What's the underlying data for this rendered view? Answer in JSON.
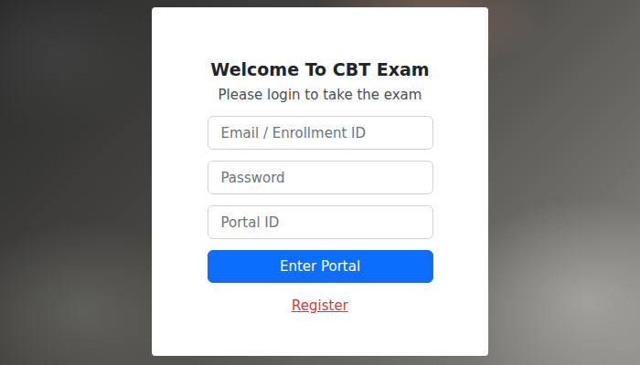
{
  "login": {
    "title": "Welcome To CBT Exam",
    "subtitle": "Please login to take the exam",
    "fields": [
      {
        "placeholder": "Email / Enrollment ID"
      },
      {
        "placeholder": "Password"
      },
      {
        "placeholder": "Portal ID"
      }
    ],
    "submit": "Enter Portal",
    "register": "Register"
  }
}
